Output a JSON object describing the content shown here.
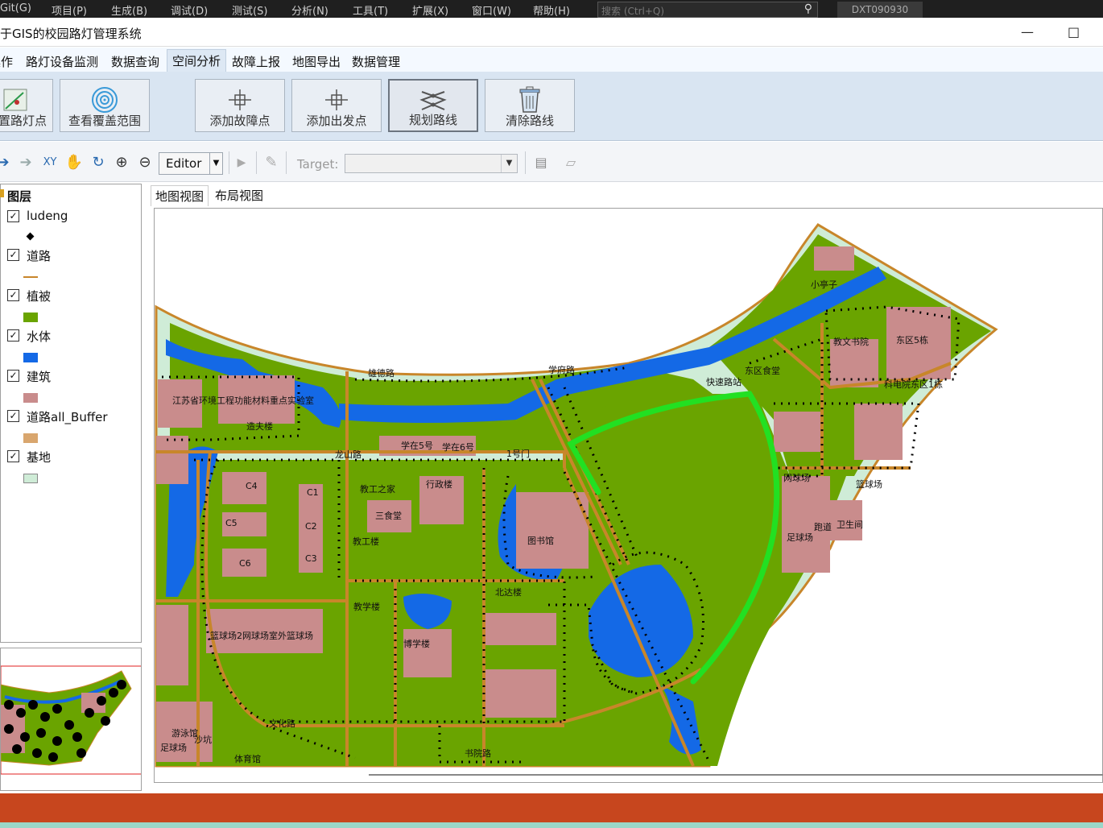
{
  "vs_menu": {
    "items": [
      "Git(G)",
      "项目(P)",
      "生成(B)",
      "调试(D)",
      "测试(S)",
      "分析(N)",
      "工具(T)",
      "扩展(X)",
      "窗口(W)",
      "帮助(H)"
    ],
    "search_placeholder": "搜索 (Ctrl+Q)",
    "user": "DXT090930"
  },
  "window": {
    "title": "于GIS的校园路灯管理系统"
  },
  "menu_tabs": [
    "操作",
    "路灯设备监测",
    "数据查询",
    "空间分析",
    "故障上报",
    "地图导出",
    "数据管理"
  ],
  "active_menu_tab": "空间分析",
  "ribbon": {
    "buttons": [
      {
        "label": "置路灯点",
        "icon": "light-point-icon"
      },
      {
        "label": "查看覆盖范围",
        "icon": "coverage-icon"
      },
      {
        "label": "添加故障点",
        "icon": "crosshair-icon"
      },
      {
        "label": "添加出发点",
        "icon": "crosshair-icon"
      },
      {
        "label": "规划路线",
        "icon": "route-icon"
      },
      {
        "label": "清除路线",
        "icon": "trash-icon"
      }
    ]
  },
  "toolbar": {
    "editor_label": "Editor",
    "target_label": "Target:",
    "target_value": ""
  },
  "toc": {
    "header": "图层",
    "layers": [
      {
        "name": "ludeng",
        "checked": true,
        "symbol": "#000000"
      },
      {
        "name": "道路",
        "checked": true,
        "symbol": "#c8862a"
      },
      {
        "name": "植被",
        "checked": true,
        "symbol": "#6aa400"
      },
      {
        "name": "水体",
        "checked": true,
        "symbol": "#1469e6"
      },
      {
        "name": "建筑",
        "checked": true,
        "symbol": "#c98c8c"
      },
      {
        "name": "道路all_Buffer",
        "checked": true,
        "symbol": "#d9a66e"
      },
      {
        "name": "基地",
        "checked": true,
        "symbol": "#cfecd7"
      }
    ]
  },
  "map_tabs": [
    "地图视图",
    "布局视图"
  ],
  "map_labels": {
    "road_1": "雄德路",
    "road_2": "学府路",
    "road_3": "龙山路",
    "road_4": "文化路",
    "road_5": "书院路",
    "gate": "1号门",
    "lib": "图书馆",
    "canteen": "三食堂",
    "xz": "行政楼",
    "jg": "教工之家",
    "dorm1": "学在5号",
    "dorm2": "学在6号",
    "c4": "C4",
    "c5": "C5",
    "c6": "C6",
    "c1": "C1",
    "c2": "C2",
    "c3": "C3",
    "court": "网球场",
    "foot": "足球场",
    "gym": "体育馆",
    "east": "东区食堂",
    "area": "东区5栋",
    "label_a": "江苏省环境工程功能材料重点实验室",
    "label_b": "造夫楼",
    "label_c": "教工楼",
    "label_d": "足球场",
    "label_e": "篮球场2网球场室外篮球场",
    "label_f": "教学楼",
    "label_g": "博学楼",
    "label_h": "小亭子",
    "label_i": "教文书院",
    "label_j": "科电院东区1栋",
    "label_k": "北达楼",
    "label_l": "快速路站",
    "label_m": "卫生间",
    "label_n": "跑道",
    "label_o": "游泳馆",
    "label_p": "沙坑",
    "label_q": "篮球场"
  },
  "colors": {
    "background": "#ffffff",
    "campus_base": "#cfecd7",
    "vegetation": "#6aa400",
    "water": "#1469e6",
    "building": "#c98c8c",
    "road": "#c8862a",
    "route": "#22e022"
  }
}
